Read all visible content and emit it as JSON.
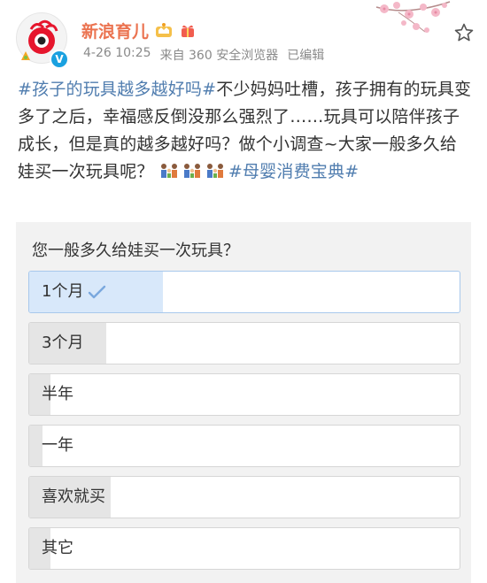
{
  "account": {
    "name": "新浪育儿",
    "verified_icon": "verified-v-icon"
  },
  "post_meta": {
    "time": "4-26 10:25",
    "source": "来自 360 安全浏览器",
    "edited": "已编辑"
  },
  "post": {
    "hashtag_1": "#孩子的玩具越多越好吗#",
    "body": "不少妈妈吐槽，孩子拥有的玩具变多了之后，幸福感反倒没那么强烈了……玩具可以陪伴孩子成长，但是真的越多越好吗？做个小调查~大家一般多久给娃买一次玩具呢？",
    "hashtag_2": "#母婴消费宝典#",
    "emoji_icon": "family-icon"
  },
  "poll": {
    "question": "您一般多久给娃买一次玩具？",
    "options": [
      {
        "label": "1个月",
        "share": 0.31,
        "selected": true
      },
      {
        "label": "3个月",
        "share": 0.18,
        "selected": false
      },
      {
        "label": "半年",
        "share": 0.05,
        "selected": false
      },
      {
        "label": "一年",
        "share": 0.03,
        "selected": false
      },
      {
        "label": "喜欢就买",
        "share": 0.19,
        "selected": false
      },
      {
        "label": "其它",
        "share": 0.05,
        "selected": false
      }
    ]
  },
  "colors": {
    "name": "#eb7350",
    "hashtag": "#507daf",
    "selected_fill": "#d8e8fa",
    "fill": "#e5e5e5"
  }
}
